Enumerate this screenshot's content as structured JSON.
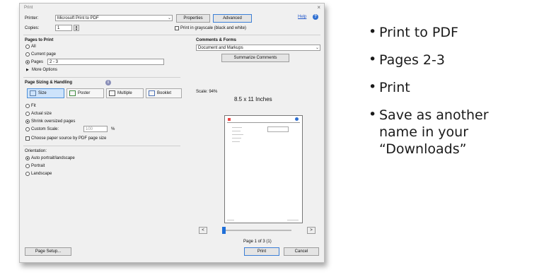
{
  "dialog": {
    "title": "Print",
    "close": "×",
    "printer_label": "Printer:",
    "printer_value": "Microsoft Print to PDF",
    "properties_btn": "Properties",
    "advanced_btn": "Advanced",
    "help_link": "Help",
    "help_icon": "?",
    "copies_label": "Copies:",
    "copies_value": "1",
    "grayscale_label": "Print in grayscale (black and white)",
    "pages_to_print": {
      "heading": "Pages to Print",
      "all": "All",
      "current": "Current page",
      "pages": "Pages",
      "pages_value": "2 - 3",
      "more_options": "More Options"
    },
    "comments_forms": {
      "heading": "Comments & Forms",
      "value": "Document and Markups",
      "summarize_btn": "Summarize Comments"
    },
    "sizing": {
      "heading": "Page Sizing & Handling",
      "info": "i",
      "size": "Size",
      "poster": "Poster",
      "multiple": "Multiple",
      "booklet": "Booklet",
      "fit": "Fit",
      "actual": "Actual size",
      "shrink": "Shrink oversized pages",
      "custom": "Custom Scale:",
      "custom_value": "100",
      "percent": "%",
      "paper_source": "Choose paper source by PDF page size"
    },
    "orientation": {
      "heading": "Orientation:",
      "auto": "Auto portrait/landscape",
      "portrait": "Portrait",
      "landscape": "Landscape"
    },
    "preview": {
      "scale": "Scale: 94%",
      "paper": "8.5 x 11 Inches",
      "page_counter": "Page 1 of 3 (1)",
      "prev": "<",
      "next": ">"
    },
    "page_setup_btn": "Page Setup...",
    "print_btn": "Print",
    "cancel_btn": "Cancel"
  },
  "bullets": [
    {
      "text": "Print to PDF"
    },
    {
      "text": "Pages 2-3"
    },
    {
      "text": "Print"
    },
    {
      "text": "Save as another name in your “Downloads”"
    }
  ],
  "bullet_lines": {
    "line4a": "Save as another",
    "line4b": "name in your",
    "line4c": "“Downloads”"
  },
  "colors": {
    "accent": "#2f6fd1",
    "dialog_bg": "#f0f0f0",
    "selected_size_bg": "#cde3fb"
  }
}
